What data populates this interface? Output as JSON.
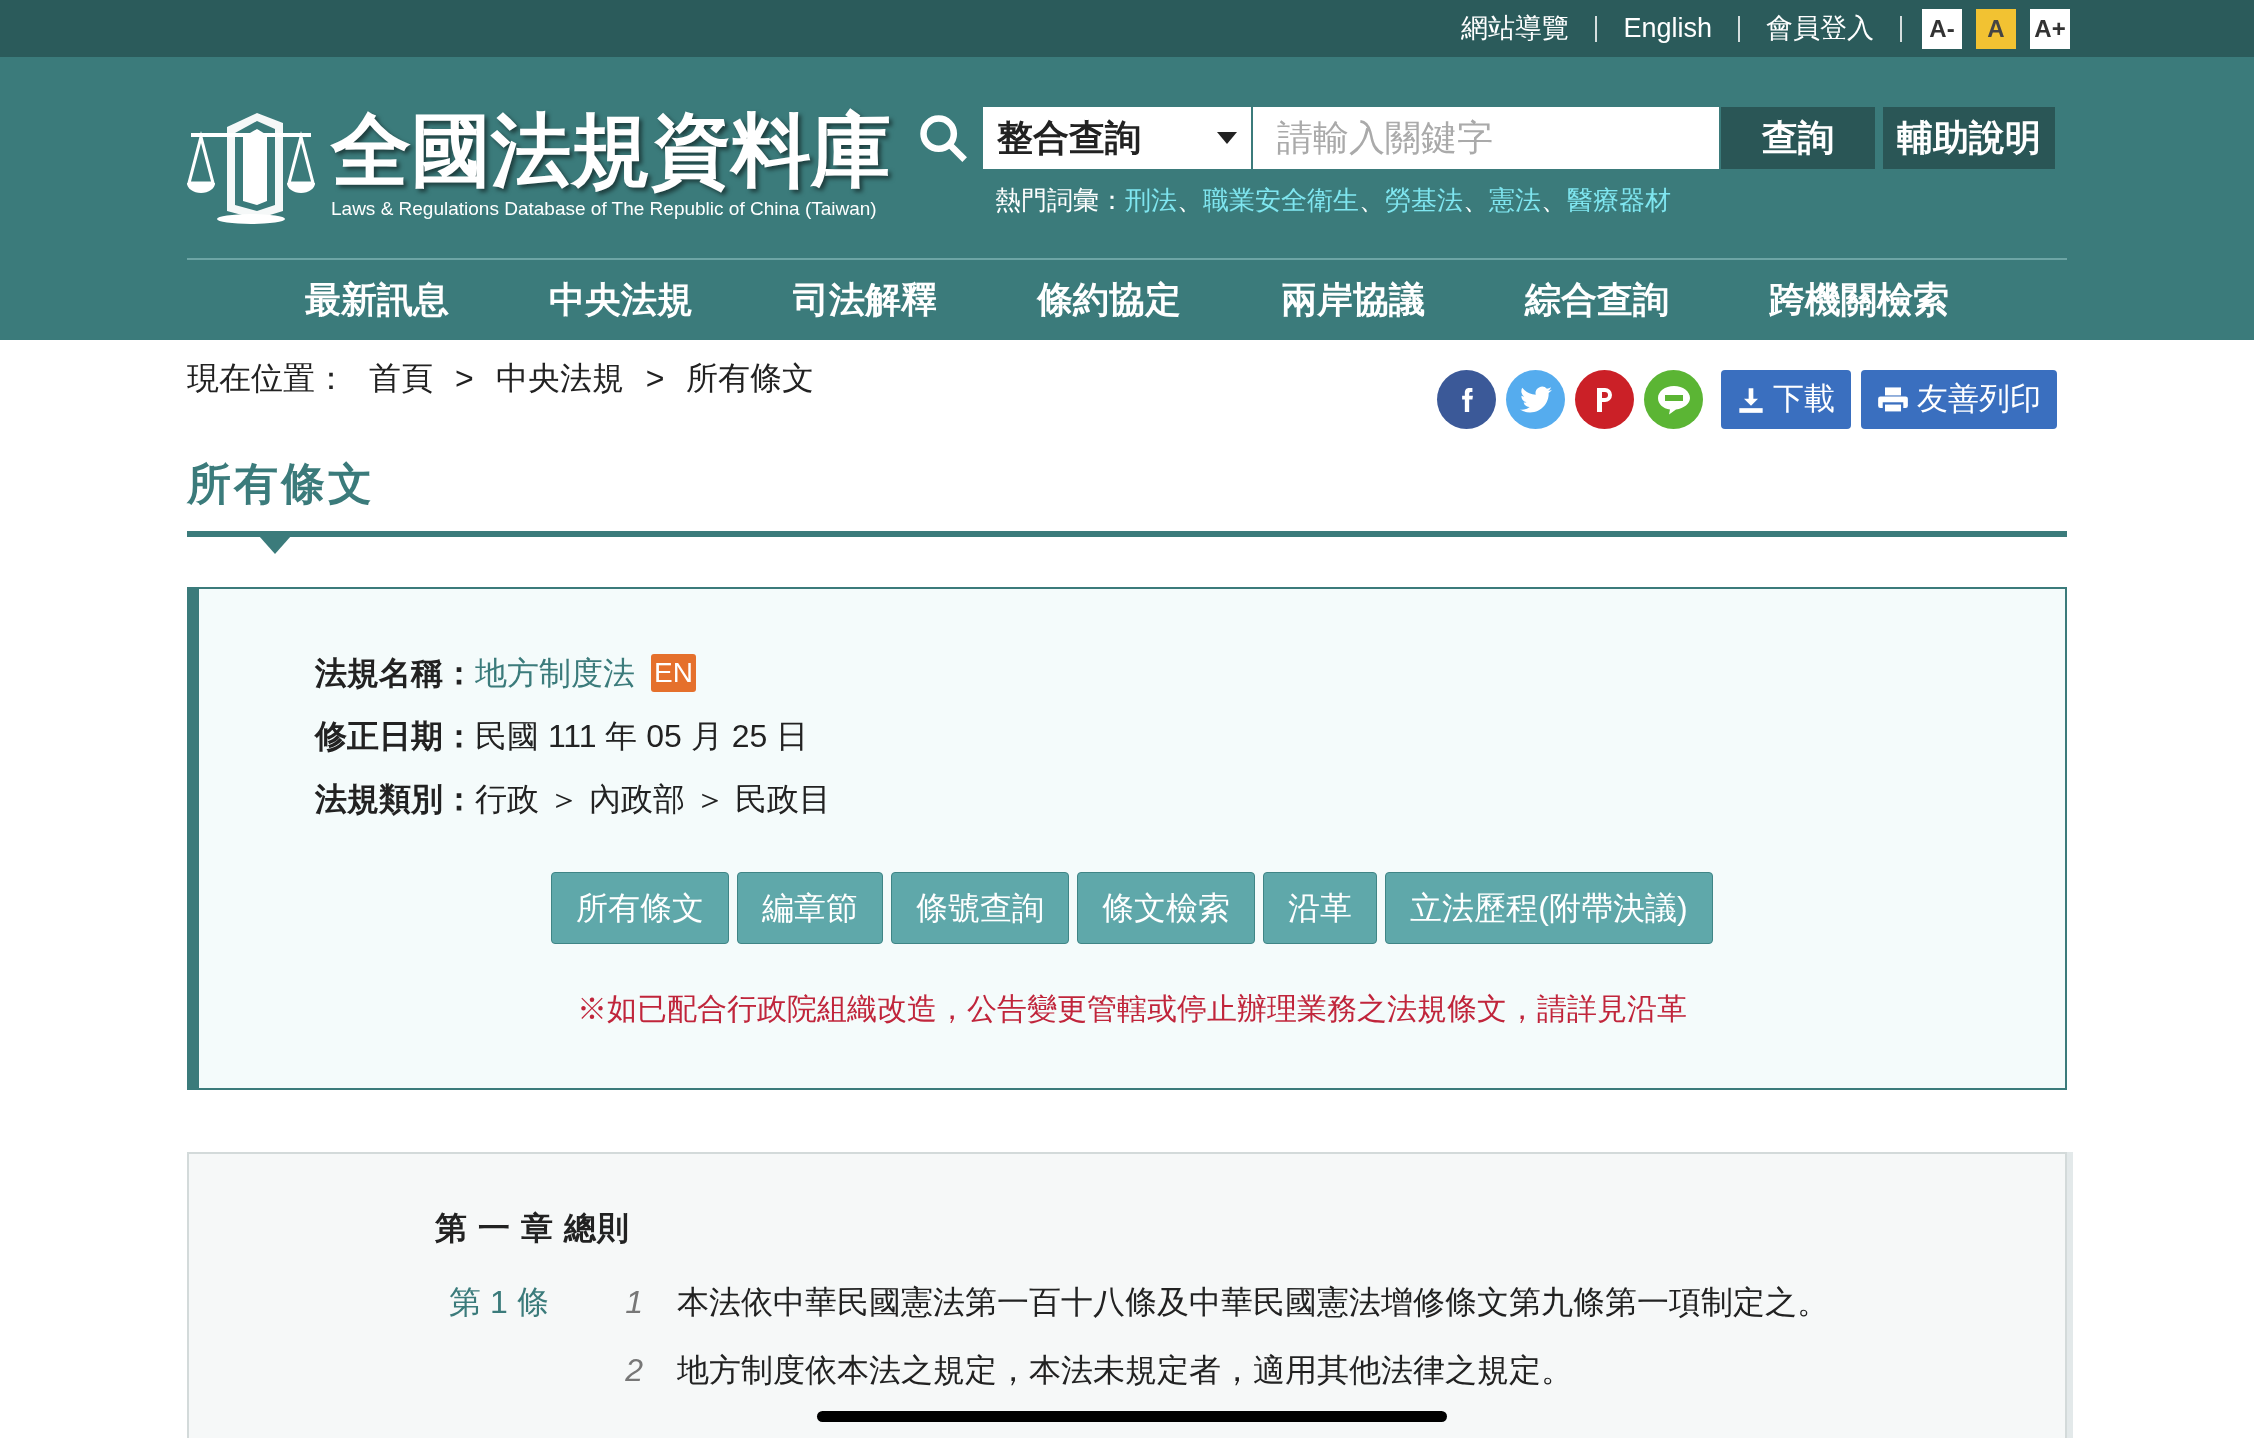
{
  "top_links": [
    "網站導覽",
    "English",
    "會員登入"
  ],
  "font_size_buttons": [
    {
      "label": "A-",
      "selected": false
    },
    {
      "label": "A",
      "selected": true
    },
    {
      "label": "A+",
      "selected": false
    }
  ],
  "logo": {
    "title": "全國法規資料庫",
    "subtitle": "Laws & Regulations Database of The Republic of China (Taiwan)"
  },
  "search": {
    "scope": "整合查詢",
    "placeholder": "請輸入關鍵字",
    "submit": "查詢",
    "help": "輔助說明"
  },
  "hot_terms": {
    "label": "熱門詞彙：",
    "terms": [
      "刑法",
      "職業安全衛生",
      "勞基法",
      "憲法",
      "醫療器材"
    ],
    "separator": "、"
  },
  "nav": [
    "最新訊息",
    "中央法規",
    "司法解釋",
    "條約協定",
    "兩岸協議",
    "綜合查詢",
    "跨機關檢索"
  ],
  "breadcrumb": {
    "label": "現在位置：",
    "items": [
      "首頁",
      "中央法規",
      "所有條文"
    ],
    "separator": ">"
  },
  "share": [
    {
      "kind": "facebook",
      "color": "#3b5998"
    },
    {
      "kind": "twitter",
      "color": "#55acee"
    },
    {
      "kind": "pinterest",
      "color": "#cb2027"
    },
    {
      "kind": "line",
      "color": "#5bb534"
    }
  ],
  "actions": [
    {
      "kind": "download",
      "label": "下載"
    },
    {
      "kind": "print",
      "label": "友善列印"
    }
  ],
  "page_title": "所有條文",
  "info": [
    {
      "label": "法規名稱：",
      "kind": "link",
      "value": "地方制度法",
      "badge": "EN"
    },
    {
      "label": "修正日期：",
      "kind": "text",
      "value": "民國 111 年 05 月 25 日"
    },
    {
      "label": "法規類別：",
      "kind": "text",
      "value": "行政 ＞ 內政部 ＞ 民政目"
    }
  ],
  "tabs": [
    "所有條文",
    "編章節",
    "條號查詢",
    "條文檢索",
    "沿革",
    "立法歷程(附帶決議)"
  ],
  "notice": "※如已配合行政院組織改造，公告變更管轄或停止辦理業務之法規條文，請詳見沿革",
  "chapter": "第 一 章 總則",
  "articles": [
    {
      "number": "第 1 條",
      "paragraphs": [
        {
          "index": "1",
          "text": "本法依中華民國憲法第一百十八條及中華民國憲法增修條文第九條第一項制定之。"
        },
        {
          "index": "2",
          "text": "地方制度依本法之規定，本法未規定者，適用其他法律之規定。"
        }
      ]
    }
  ]
}
